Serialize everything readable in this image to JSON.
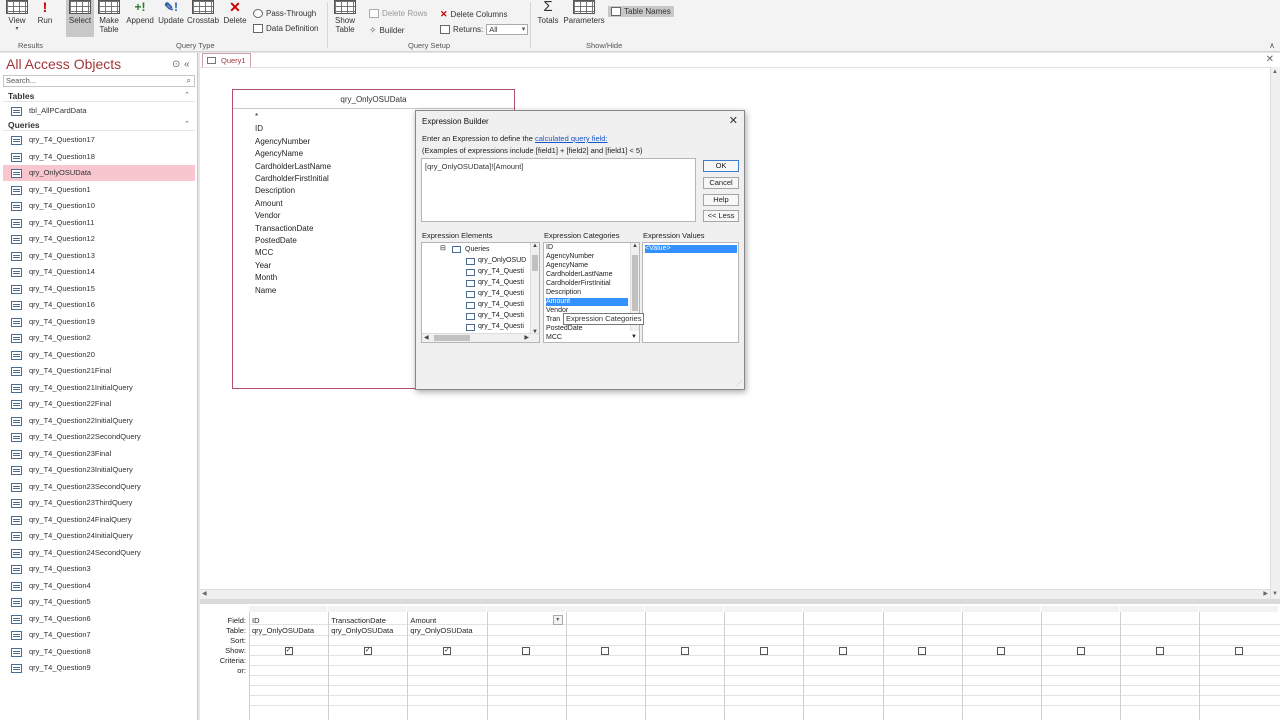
{
  "ribbon": {
    "buttons": [
      {
        "key": "view",
        "label": "View"
      },
      {
        "key": "run",
        "label": "Run"
      },
      {
        "key": "select",
        "label": "Select"
      },
      {
        "key": "make_table",
        "label": "Make Table"
      },
      {
        "key": "append",
        "label": "Append"
      },
      {
        "key": "update",
        "label": "Update"
      },
      {
        "key": "crosstab",
        "label": "Crosstab"
      },
      {
        "key": "delete",
        "label": "Delete"
      },
      {
        "key": "show_table",
        "label": "Show Table"
      },
      {
        "key": "totals",
        "label": "Totals"
      },
      {
        "key": "parameters",
        "label": "Parameters"
      }
    ],
    "small": {
      "pass_through": "Pass-Through",
      "data_definition": "Data Definition",
      "delete_rows": "Delete Rows",
      "delete_columns": "Delete Columns",
      "builder": "Builder",
      "returns": "Returns:",
      "returns_value": "All",
      "table_names": "Table Names"
    },
    "groups": {
      "results": "Results",
      "query_type": "Query Type",
      "query_setup": "Query Setup",
      "show_hide": "Show/Hide"
    }
  },
  "nav": {
    "title": "All Access Objects",
    "search_placeholder": "Search...",
    "tables_header": "Tables",
    "tables": [
      "tbl_AllPCardData"
    ],
    "queries_header": "Queries",
    "queries": [
      "qry_T4_Question17",
      "qry_T4_Question18",
      "qry_OnlyOSUData",
      "qry_T4_Question1",
      "qry_T4_Question10",
      "qry_T4_Question11",
      "qry_T4_Question12",
      "qry_T4_Question13",
      "qry_T4_Question14",
      "qry_T4_Question15",
      "qry_T4_Question16",
      "qry_T4_Question19",
      "qry_T4_Question2",
      "qry_T4_Question20",
      "qry_T4_Question21Final",
      "qry_T4_Question21InitialQuery",
      "qry_T4_Question22Final",
      "qry_T4_Question22InitialQuery",
      "qry_T4_Question22SecondQuery",
      "qry_T4_Question23Final",
      "qry_T4_Question23InitialQuery",
      "qry_T4_Question23SecondQuery",
      "qry_T4_Question23ThirdQuery",
      "qry_T4_Question24FinalQuery",
      "qry_T4_Question24InitialQuery",
      "qry_T4_Question24SecondQuery",
      "qry_T4_Question3",
      "qry_T4_Question4",
      "qry_T4_Question5",
      "qry_T4_Question6",
      "qry_T4_Question7",
      "qry_T4_Question8",
      "qry_T4_Question9"
    ],
    "selected_query": "qry_OnlyOSUData"
  },
  "document": {
    "tab_label": "Query1",
    "table_box": {
      "title": "qry_OnlyOSUData",
      "fields": [
        "*",
        "ID",
        "AgencyNumber",
        "AgencyName",
        "CardholderLastName",
        "CardholderFirstInitial",
        "Description",
        "Amount",
        "Vendor",
        "TransactionDate",
        "PostedDate",
        "MCC",
        "Year",
        "Month",
        "Name"
      ]
    }
  },
  "dialog": {
    "title": "Expression Builder",
    "line1_prefix": "Enter an Expression to define the",
    "line1_link": "calculated query field:",
    "line2": "(Examples of expressions include [field1] + [field2] and [field1] < 5)",
    "expression": "[qry_OnlyOSUData]![Amount]",
    "ok": "OK",
    "cancel": "Cancel",
    "help": "Help",
    "less": "<< Less",
    "elements_label": "Expression Elements",
    "categories_label": "Expression Categories",
    "values_label": "Expression Values",
    "elements": {
      "queries_node": "Queries",
      "items": [
        "qry_OnlyOSUD",
        "qry_T4_Questi",
        "qry_T4_Questi",
        "qry_T4_Questi",
        "qry_T4_Questi",
        "qry_T4_Questi",
        "qry_T4_Questi",
        "qry_T4_Questi"
      ]
    },
    "categories": [
      "ID",
      "AgencyNumber",
      "AgencyName",
      "CardholderLastName",
      "CardholderFirstInitial",
      "Description",
      "Amount",
      "Vendor",
      "Tran",
      "PostedDate",
      "MCC"
    ],
    "selected_category": "Amount",
    "values": [
      "<Value>"
    ],
    "tooltip": "Expression Categories"
  },
  "grid": {
    "row_labels": [
      "Field:",
      "Table:",
      "Sort:",
      "Show:",
      "Criteria:",
      "or:"
    ],
    "columns": [
      {
        "field": "ID",
        "table": "qry_OnlyOSUData",
        "show": true
      },
      {
        "field": "TransactionDate",
        "table": "qry_OnlyOSUData",
        "show": true
      },
      {
        "field": "Amount",
        "table": "qry_OnlyOSUData",
        "show": true
      },
      {
        "field": "",
        "table": "",
        "show": false
      },
      {
        "field": "",
        "table": "",
        "show": false
      },
      {
        "field": "",
        "table": "",
        "show": false
      },
      {
        "field": "",
        "table": "",
        "show": false
      },
      {
        "field": "",
        "table": "",
        "show": false
      },
      {
        "field": "",
        "table": "",
        "show": false
      },
      {
        "field": "",
        "table": "",
        "show": false
      },
      {
        "field": "",
        "table": "",
        "show": false
      },
      {
        "field": "",
        "table": "",
        "show": false
      },
      {
        "field": "",
        "table": "",
        "show": false
      }
    ]
  }
}
